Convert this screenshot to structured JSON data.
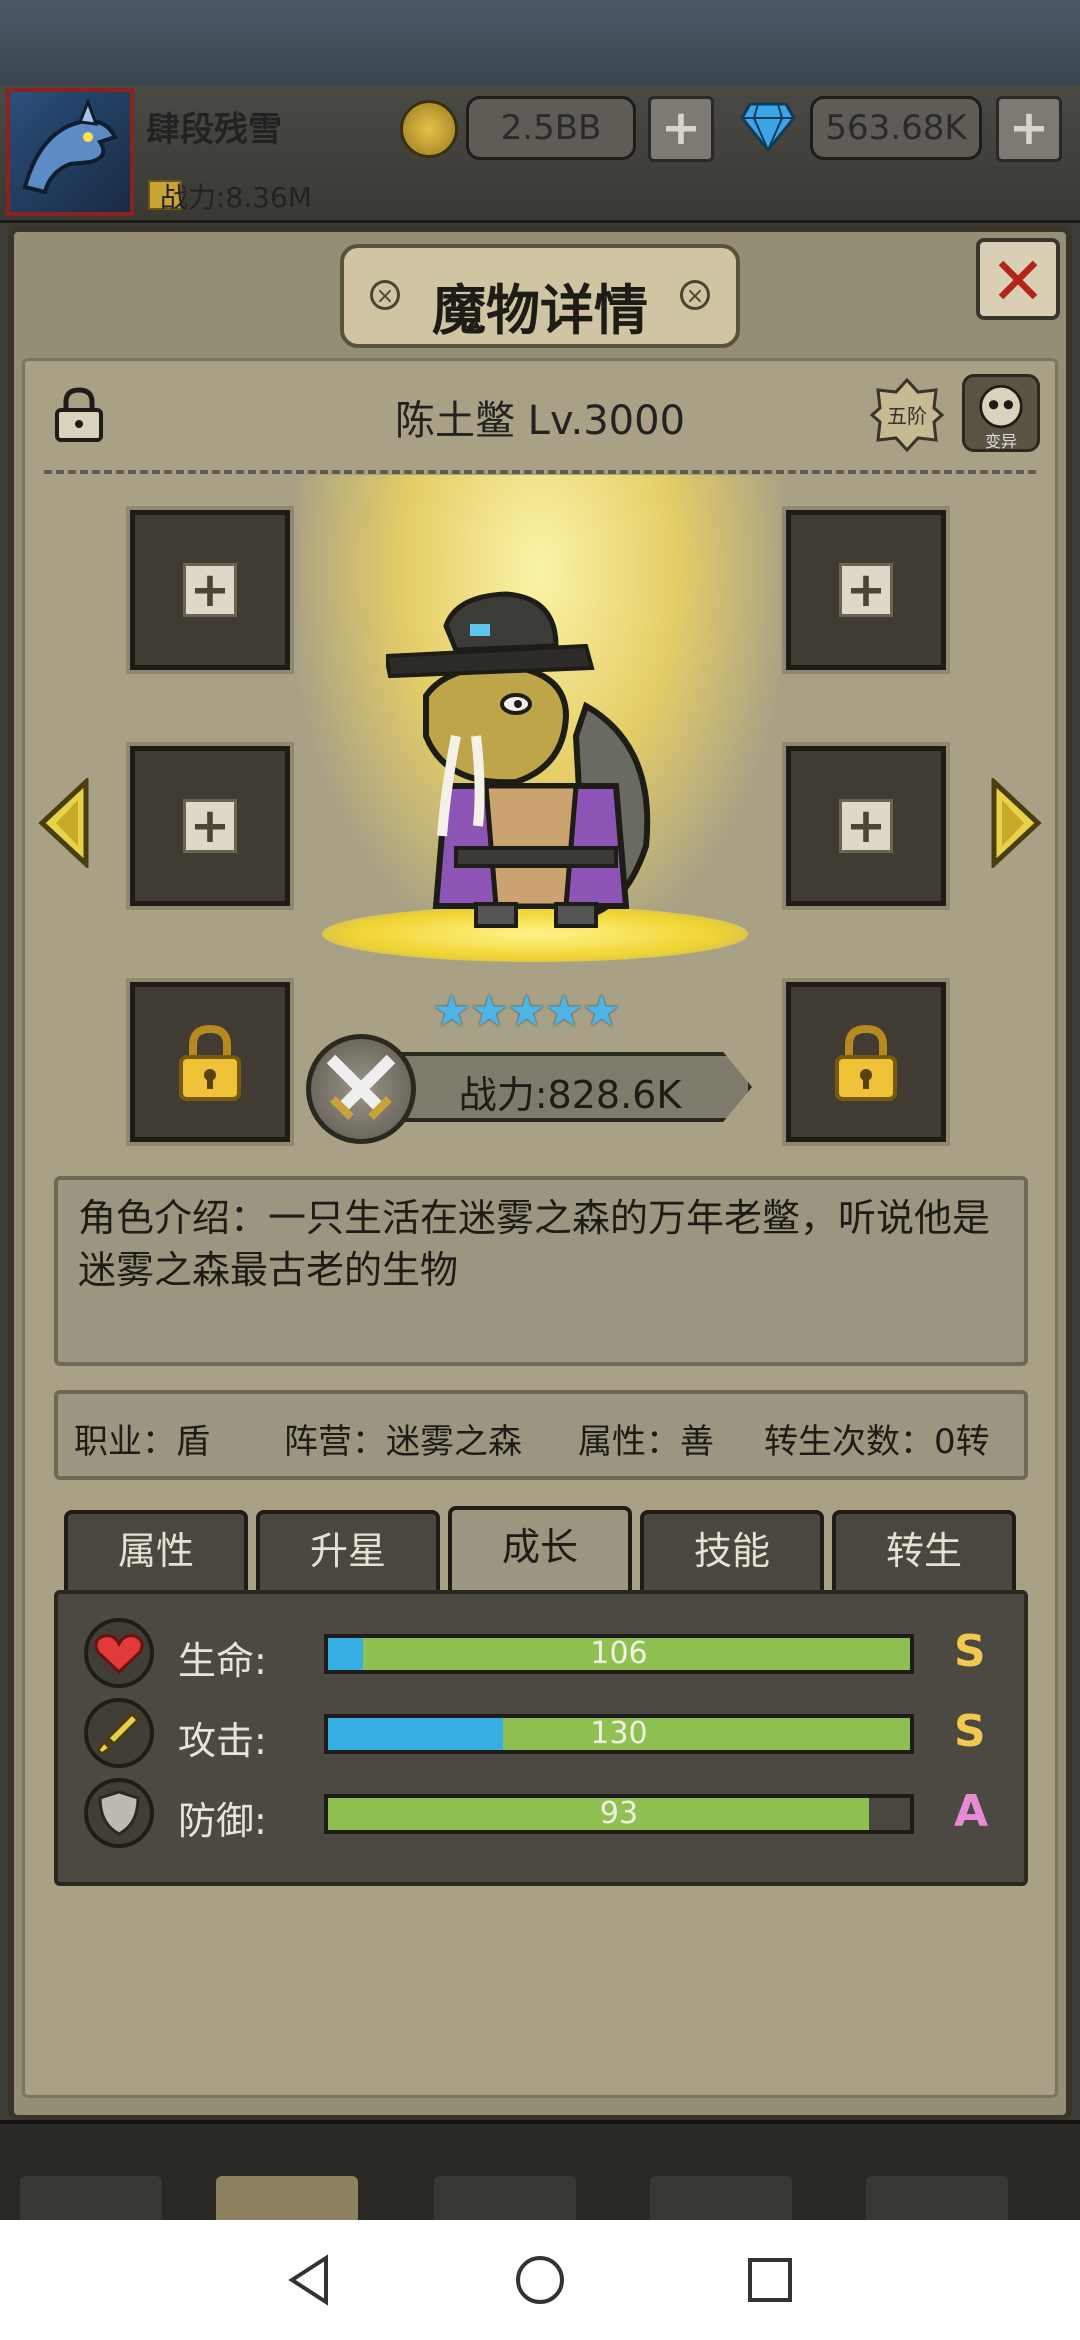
{
  "player": {
    "name": "肆段残雪",
    "power": "战力:8.36M",
    "gold": "2.5BB",
    "gems": "563.68K"
  },
  "dialog": {
    "title": "魔物详情",
    "close_label": "✕"
  },
  "monster": {
    "name_level": "陈土鳖 Lv.3000",
    "rank": "五阶",
    "mutate_label": "变异",
    "stars": 5,
    "power": "战力:828.6K",
    "description": "角色介绍：一只生活在迷雾之森的万年老鳖，听说他是迷雾之森最古老的生物",
    "info": {
      "job": "职业：盾",
      "faction": "阵营：迷雾之森",
      "attribute": "属性：善",
      "rebirth": "转生次数：0转"
    }
  },
  "equip_slots": [
    {
      "state": "empty",
      "icon": "plus-icon"
    },
    {
      "state": "empty",
      "icon": "plus-icon"
    },
    {
      "state": "empty",
      "icon": "plus-icon"
    },
    {
      "state": "empty",
      "icon": "plus-icon"
    },
    {
      "state": "locked",
      "icon": "lock-icon"
    },
    {
      "state": "locked",
      "icon": "lock-icon"
    }
  ],
  "tabs": [
    {
      "label": "属性"
    },
    {
      "label": "升星"
    },
    {
      "label": "成长",
      "active": true
    },
    {
      "label": "技能"
    },
    {
      "label": "转生"
    }
  ],
  "growth": [
    {
      "label": "生命:",
      "value": "106",
      "grade": "S",
      "fill": 1.0,
      "blue": 0.06,
      "icon": "heart-icon",
      "grade_color": "#f2c94c"
    },
    {
      "label": "攻击:",
      "value": "130",
      "grade": "S",
      "fill": 1.0,
      "blue": 0.3,
      "icon": "sword-icon",
      "grade_color": "#f2c94c"
    },
    {
      "label": "防御:",
      "value": "93",
      "grade": "A",
      "fill": 0.93,
      "blue": 0,
      "icon": "shield-icon",
      "grade_color": "#e68bd6"
    }
  ],
  "colors": {
    "bar_green": "#8fc152",
    "bar_blue": "#36aee3",
    "star": "#4fb5e6",
    "close": "#b52418"
  }
}
